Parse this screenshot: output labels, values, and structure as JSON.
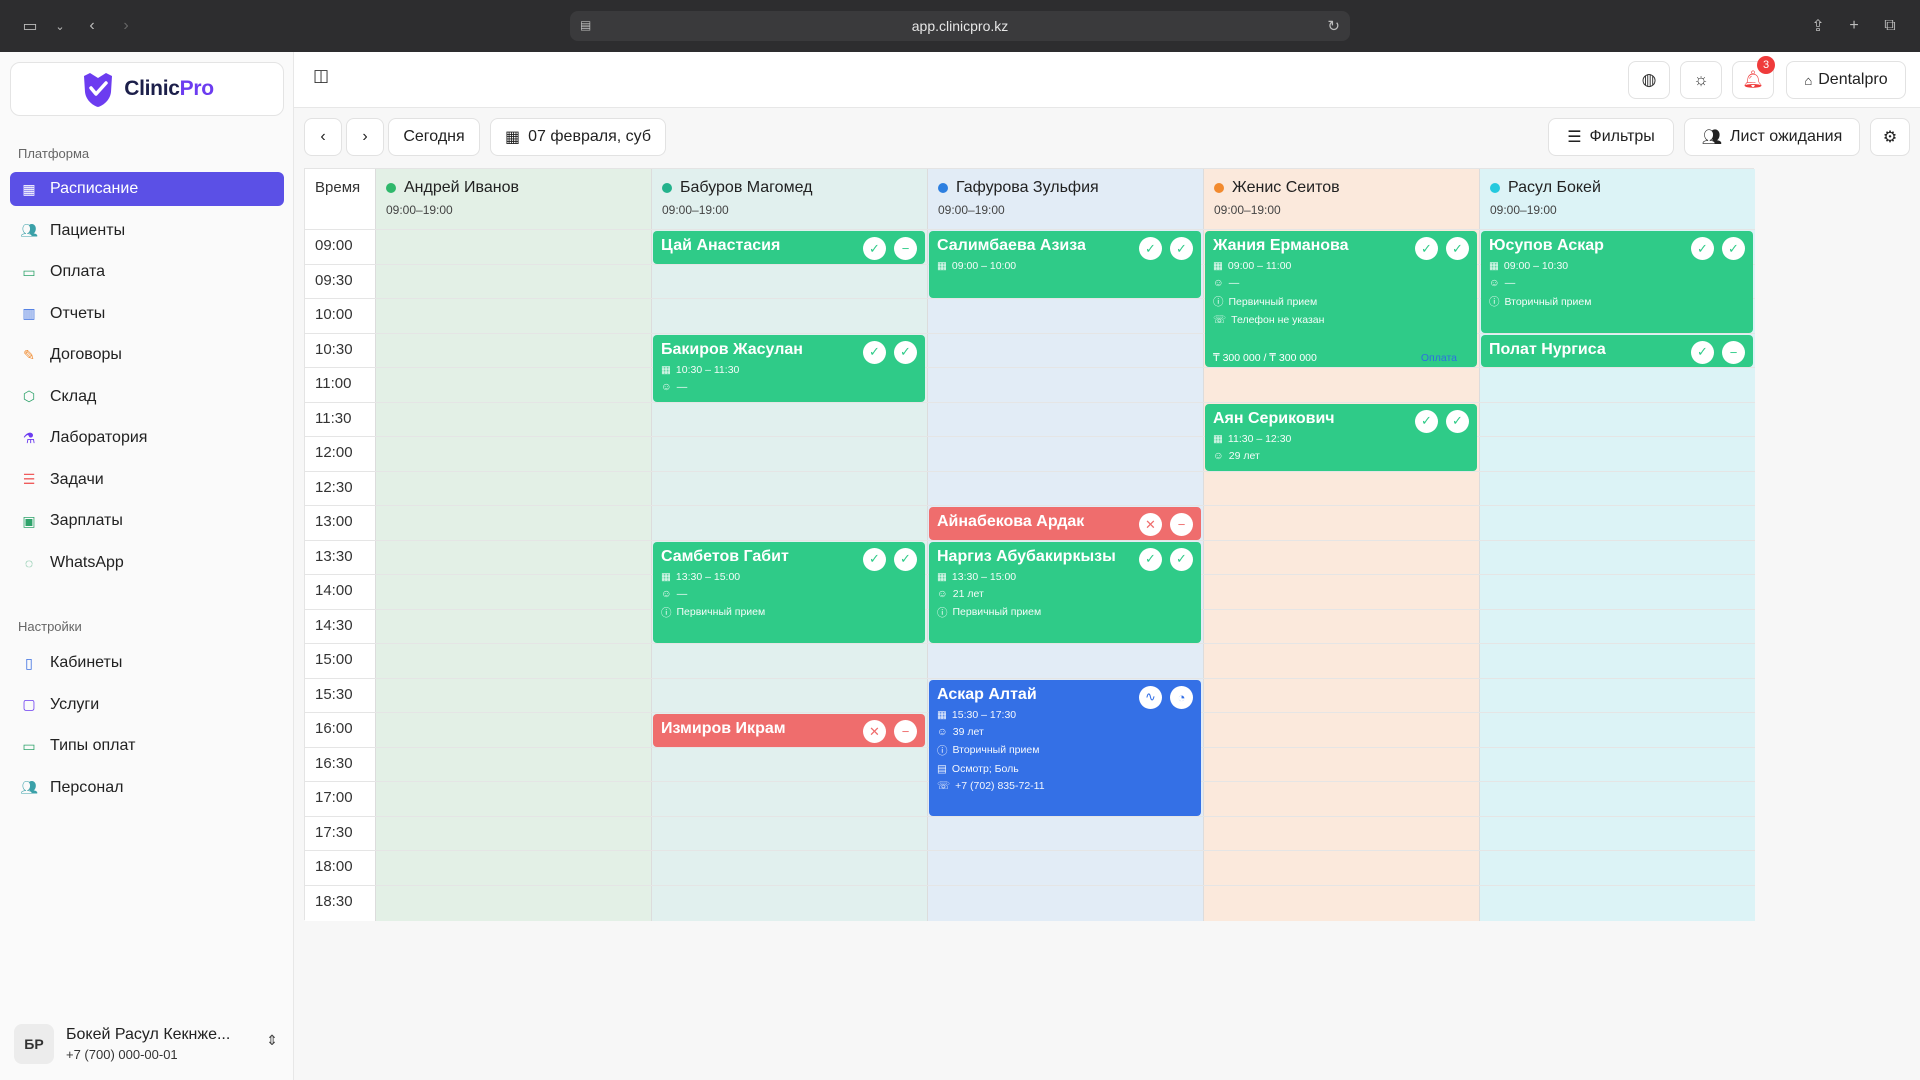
{
  "browser": {
    "url": "app.clinicpro.kz"
  },
  "brand": {
    "name_a": "Clinic",
    "name_b": "Pro"
  },
  "sidebar": {
    "platform_label": "Платформа",
    "platform_items": [
      {
        "label": "Расписание",
        "icon": "calendar-icon",
        "active": true
      },
      {
        "label": "Пациенты",
        "icon": "users-icon"
      },
      {
        "label": "Оплата",
        "icon": "credit-card-icon"
      },
      {
        "label": "Отчеты",
        "icon": "bar-chart-icon"
      },
      {
        "label": "Договоры",
        "icon": "contract-icon"
      },
      {
        "label": "Склад",
        "icon": "box-icon"
      },
      {
        "label": "Лаборатория",
        "icon": "flask-icon"
      },
      {
        "label": "Задачи",
        "icon": "tasks-icon"
      },
      {
        "label": "Зарплаты",
        "icon": "banknote-icon"
      },
      {
        "label": "WhatsApp",
        "icon": "whatsapp-icon"
      }
    ],
    "settings_label": "Настройки",
    "settings_items": [
      {
        "label": "Кабинеты",
        "icon": "map-icon"
      },
      {
        "label": "Услуги",
        "icon": "book-icon"
      },
      {
        "label": "Типы оплат",
        "icon": "credit-card-icon"
      },
      {
        "label": "Персонал",
        "icon": "users-icon"
      }
    ],
    "user": {
      "initials": "БР",
      "name": "Бокей Расул Кекнже...",
      "phone": "+7 (700) 000-00-01"
    }
  },
  "header": {
    "notifications_count": "3",
    "clinic_name": "Dentalpro"
  },
  "toolbar": {
    "today_label": "Сегодня",
    "date_label": "07 февраля, суб",
    "filters_label": "Фильтры",
    "waitlist_label": "Лист ожидания"
  },
  "schedule": {
    "time_header": "Время",
    "times": [
      "09:00",
      "09:30",
      "10:00",
      "10:30",
      "11:00",
      "11:30",
      "12:00",
      "12:30",
      "13:00",
      "13:30",
      "14:00",
      "14:30",
      "15:00",
      "15:30",
      "16:00",
      "16:30",
      "17:00",
      "17:30",
      "18:00",
      "18:30"
    ],
    "doctors": [
      {
        "name": "Андрей Иванов",
        "hours": "09:00–19:00",
        "dot": "#2fb86b",
        "bg": "#e3f0e6"
      },
      {
        "name": "Бабуров Магомед",
        "hours": "09:00–19:00",
        "dot": "#23b28c",
        "bg": "#e1f0ee"
      },
      {
        "name": "Гафурова Зульфия",
        "hours": "09:00–19:00",
        "dot": "#2d7fe0",
        "bg": "#e2ecf6"
      },
      {
        "name": "Женис Сеитов",
        "hours": "09:00–19:00",
        "dot": "#f28a2e",
        "bg": "#fbe9dc"
      },
      {
        "name": "Расул Бокей",
        "hours": "09:00–19:00",
        "dot": "#24c9de",
        "bg": "#dcf3f6"
      }
    ],
    "appointments": [
      {
        "doc": 1,
        "start": 0,
        "dur": 1,
        "color": "green",
        "name": "Цай Анастасия",
        "lines": [],
        "icons": [
          "check-circle-icon",
          "minus-circle-icon"
        ]
      },
      {
        "doc": 1,
        "start": 3,
        "dur": 2,
        "color": "green",
        "name": "Бакиров Жасулан",
        "lines": [
          [
            "calendar-icon",
            "10:30 – 11:30"
          ],
          [
            "user-icon",
            "—"
          ]
        ],
        "icons": [
          "check-circle-icon",
          "check-circle-icon"
        ]
      },
      {
        "doc": 1,
        "start": 9,
        "dur": 3,
        "color": "green",
        "name": "Самбетов Габит",
        "lines": [
          [
            "calendar-icon",
            "13:30 – 15:00"
          ],
          [
            "user-icon",
            "—"
          ],
          [
            "info-icon",
            "Первичный прием"
          ]
        ],
        "icons": [
          "check-circle-icon",
          "check-circle-icon"
        ]
      },
      {
        "doc": 1,
        "start": 14,
        "dur": 1,
        "color": "red",
        "name": "Измиров Икрам",
        "lines": [],
        "icons": [
          "user-x-icon",
          "minus-circle-icon"
        ]
      },
      {
        "doc": 2,
        "start": 0,
        "dur": 2,
        "color": "green",
        "name": "Салимбаева Азиза",
        "lines": [
          [
            "calendar-icon",
            "09:00 – 10:00"
          ]
        ],
        "icons": [
          "check-circle-icon",
          "check-circle-icon"
        ]
      },
      {
        "doc": 2,
        "start": 8,
        "dur": 1,
        "color": "red",
        "name": "Айнабекова Ардак",
        "lines": [],
        "icons": [
          "user-x-icon",
          "minus-circle-icon"
        ]
      },
      {
        "doc": 2,
        "start": 9,
        "dur": 3,
        "color": "green",
        "name": "Наргиз Абубакиркызы",
        "lines": [
          [
            "calendar-icon",
            "13:30 – 15:00"
          ],
          [
            "user-icon",
            "21 лет"
          ],
          [
            "info-icon",
            "Первичный прием"
          ]
        ],
        "icons": [
          "check-circle-icon",
          "check-circle-icon"
        ]
      },
      {
        "doc": 2,
        "start": 13,
        "dur": 4,
        "color": "blue",
        "name": "Аскар Алтай",
        "lines": [
          [
            "calendar-icon",
            "15:30 – 17:30"
          ],
          [
            "user-icon",
            "39 лет"
          ],
          [
            "info-icon",
            "Вторичный прием"
          ],
          [
            "clipboard-icon",
            "Осмотр; Боль"
          ],
          [
            "phone-icon",
            "+7 (702) 835-72-11"
          ]
        ],
        "icons": [
          "activity-icon",
          "clock-icon"
        ]
      },
      {
        "doc": 3,
        "start": 0,
        "dur": 4,
        "color": "green",
        "name": "Жания Ерманова",
        "lines": [
          [
            "calendar-icon",
            "09:00 – 11:00"
          ],
          [
            "user-icon",
            "—"
          ],
          [
            "info-icon",
            "Первичный прием"
          ],
          [
            "phone-icon",
            "Телефон не указан"
          ]
        ],
        "price": "₸ 300 000 / ₸ 300 000",
        "paid": "Оплата",
        "icons": [
          "check-circle-icon",
          "check-circle-icon"
        ]
      },
      {
        "doc": 3,
        "start": 5,
        "dur": 2,
        "color": "green",
        "name": "Аян Серикович",
        "lines": [
          [
            "calendar-icon",
            "11:30 – 12:30"
          ],
          [
            "user-icon",
            "29 лет"
          ]
        ],
        "icons": [
          "check-circle-icon",
          "check-circle-icon"
        ]
      },
      {
        "doc": 4,
        "start": 0,
        "dur": 3,
        "color": "green",
        "name": "Юсупов Аскар",
        "lines": [
          [
            "calendar-icon",
            "09:00 – 10:30"
          ],
          [
            "user-icon",
            "—"
          ],
          [
            "info-icon",
            "Вторичный прием"
          ]
        ],
        "icons": [
          "check-circle-icon",
          "check-circle-icon"
        ]
      },
      {
        "doc": 4,
        "start": 3,
        "dur": 1,
        "color": "green",
        "name": "Полат Нургиса",
        "lines": [],
        "icons": [
          "check-circle-icon",
          "minus-circle-icon"
        ]
      }
    ]
  }
}
